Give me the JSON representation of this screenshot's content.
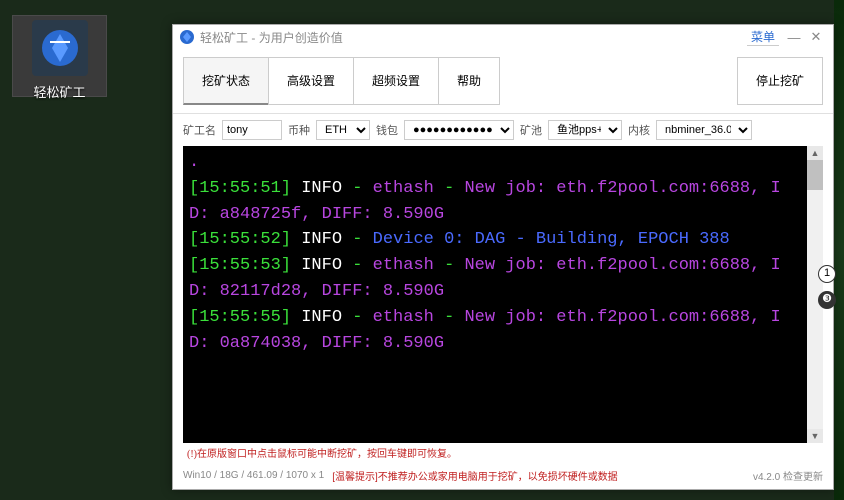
{
  "desktop": {
    "label": "轻松矿工"
  },
  "title": {
    "app_name": "轻松矿工",
    "slogan": "为用户创造价值",
    "menu": "菜单"
  },
  "tabs": {
    "mining_status": "挖矿状态",
    "advanced": "高级设置",
    "overclock": "超频设置",
    "help": "帮助",
    "stop": "停止挖矿"
  },
  "params": {
    "miner_label": "矿工名",
    "miner_value": "tony",
    "coin_label": "币种",
    "coin_value": "ETH",
    "wallet_label": "钱包",
    "wallet_value": "●●●●●●●●●●●●●",
    "pool_label": "矿池",
    "pool_value": "鱼池pps+",
    "kernel_label": "内核",
    "kernel_value": "nbminer_36.0"
  },
  "log": [
    {
      "time": "[15:55:51]",
      "level": " INFO",
      "msg1": "ethash",
      "msg2": "New job: eth.f2pool.com:6688, ID: a848725f, DIFF: 8.590G"
    },
    {
      "time": "[15:55:52]",
      "level": " INFO",
      "msg1": "Device 0: DAG - Building, EPOCH 388",
      "msg2": ""
    },
    {
      "time": "[15:55:53]",
      "level": " INFO",
      "msg1": "ethash",
      "msg2": "New job: eth.f2pool.com:6688, ID: 82117d28, DIFF: 8.590G"
    },
    {
      "time": "[15:55:55]",
      "level": " INFO",
      "msg1": "ethash",
      "msg2": "New job: eth.f2pool.com:6688, ID: 0a874038, DIFF: 8.590G"
    }
  ],
  "inline_warn": "(!)在原版窗口中点击鼠标可能中断挖矿，按回车键即可恢复。",
  "status": {
    "sysinfo": "Win10  /  18G / 461.09 / 1070 x 1",
    "hint": "[温馨提示]不推荐办公或家用电脑用于挖矿，以免损坏硬件或数据",
    "version": "v4.2.0 检查更新"
  }
}
